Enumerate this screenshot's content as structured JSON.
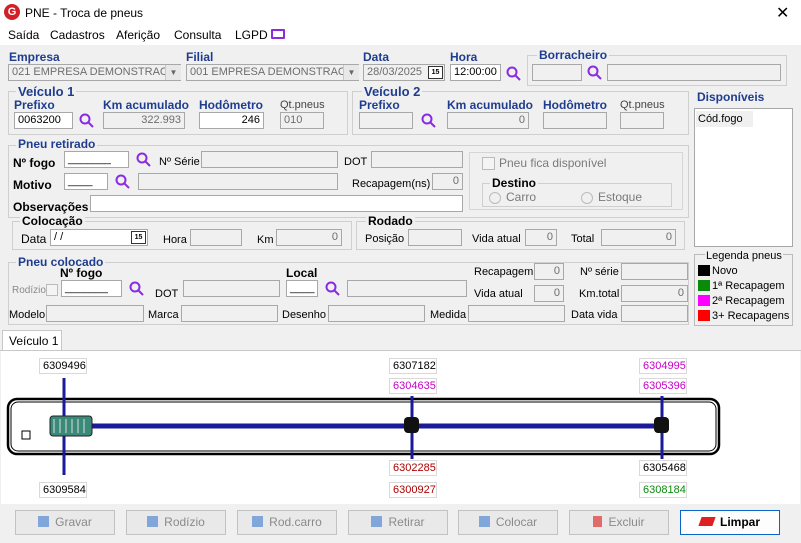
{
  "window": {
    "title": "PNE - Troca de pneus",
    "logo_letter": "G"
  },
  "menu": [
    "Saída",
    "Cadastros",
    "Aferição",
    "Consulta",
    "LGPD"
  ],
  "empresa": {
    "label": "Empresa",
    "value": "021 EMPRESA DEMONSTRAC"
  },
  "filial": {
    "label": "Filial",
    "value": "001 EMPRESA DEMONSTRAC"
  },
  "data": {
    "label": "Data",
    "value": "28/03/2025"
  },
  "hora": {
    "label": "Hora",
    "value": "12:00:00"
  },
  "borracheiro": {
    "label": "Borracheiro",
    "code": "",
    "name": ""
  },
  "veiculo1": {
    "title": "Veículo 1",
    "prefixo_label": "Prefixo",
    "prefixo": "0063200",
    "km_label": "Km acumulado",
    "km": "322.993",
    "hodometro_label": "Hodômetro",
    "hodometro": "246",
    "qt_label": "Qt.pneus",
    "qt": "010"
  },
  "veiculo2": {
    "title": "Veículo 2",
    "prefixo_label": "Prefixo",
    "prefixo": "",
    "km_label": "Km acumulado",
    "km": "0",
    "hodometro_label": "Hodômetro",
    "hodometro": "",
    "qt_label": "Qt.pneus",
    "qt": ""
  },
  "disponiveis": {
    "title": "Disponíveis",
    "col": "Cód.fogo"
  },
  "pneu_retirado": {
    "title": "Pneu retirado",
    "nfogo_label": "Nº fogo",
    "nfogo": "_______",
    "nserie_label": "Nº Série",
    "dot_label": "DOT",
    "motivo_label": "Motivo",
    "motivo": "____",
    "recap_label": "Recapagem(ns)",
    "recap": "0",
    "obs_label": "Observações",
    "fica_disp": "Pneu fica disponível",
    "destino_title": "Destino",
    "destino_carro": "Carro",
    "destino_estoque": "Estoque"
  },
  "colocacao": {
    "title": "Colocação",
    "data_label": "Data",
    "data": " /  /",
    "hora_label": "Hora",
    "km_label": "Km",
    "km": "0"
  },
  "rodado": {
    "title": "Rodado",
    "posicao_label": "Posição",
    "vida_label": "Vida atual",
    "vida": "0",
    "total_label": "Total",
    "total": "0"
  },
  "pneu_colocado": {
    "title": "Pneu colocado",
    "nfogo_label": "Nº fogo",
    "nfogo": "_______",
    "local_label": "Local",
    "local": "____",
    "rodizio_label": "Rodízio",
    "dot_label": "DOT",
    "recap_label": "Recapagem",
    "recap": "0",
    "nserie_label": "Nº série",
    "vida_label": "Vida atual",
    "vida": "0",
    "kmtotal_label": "Km.total",
    "kmtotal": "0",
    "modelo_label": "Modelo",
    "marca_label": "Marca",
    "desenho_label": "Desenho",
    "medida_label": "Medida",
    "datavida_label": "Data vida"
  },
  "legenda": {
    "title": "Legenda pneus",
    "items": [
      {
        "label": "Novo",
        "color": "#000000"
      },
      {
        "label": "1ª Recapagem",
        "color": "#0a8a0a"
      },
      {
        "label": "2ª Recapagem",
        "color": "#ff00ff"
      },
      {
        "label": "3+ Recapagens",
        "color": "#ff0000"
      }
    ]
  },
  "tab": "Veículo 1",
  "tires": {
    "axle1_top": "6309496",
    "axle1_bottom": "6309584",
    "axle2_top1": "6307182",
    "axle2_top2": "6304635",
    "axle2_bottom1": "6302285",
    "axle2_bottom2": "6300927",
    "axle3_top1": "6304995",
    "axle3_top2": "6305396",
    "axle3_bottom1": "6305468",
    "axle3_bottom2": "6308184",
    "colors": {
      "axle1_top": "#000000",
      "axle1_bottom": "#000000",
      "axle2_top1": "#000000",
      "axle2_top2": "#c800c8",
      "axle2_bottom1": "#b00000",
      "axle2_bottom2": "#b00000",
      "axle3_top1": "#c800c8",
      "axle3_top2": "#c800c8",
      "axle3_bottom1": "#000000",
      "axle3_bottom2": "#0a8a0a"
    }
  },
  "buttons": [
    "Gravar",
    "Rodízio",
    "Rod.carro",
    "Retirar",
    "Colocar",
    "Excluir",
    "Limpar"
  ]
}
